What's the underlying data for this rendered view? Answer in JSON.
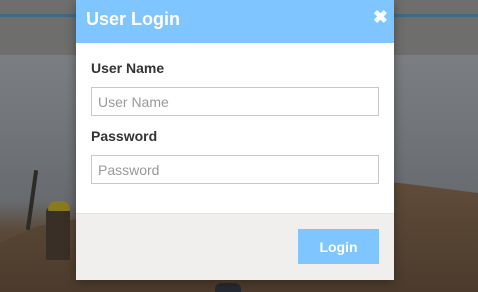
{
  "modal": {
    "title": "User Login",
    "close_glyph": "✖",
    "username": {
      "label": "User Name",
      "value": "",
      "placeholder": "User Name"
    },
    "password": {
      "label": "Password",
      "value": "",
      "placeholder": "Password"
    },
    "login_label": "Login"
  },
  "colors": {
    "accent": "#7fc5ff",
    "footer_bg": "#f0efee",
    "overlay_header": "#6e6e6c"
  },
  "icons": {
    "close": "close-icon"
  }
}
